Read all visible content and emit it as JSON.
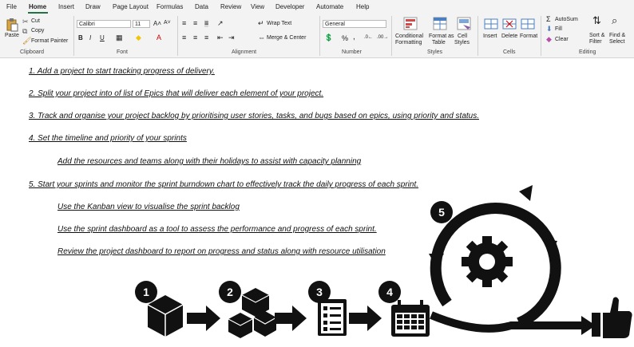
{
  "tabs": [
    "File",
    "Home",
    "Insert",
    "Draw",
    "Page Layout",
    "Formulas",
    "Data",
    "Review",
    "View",
    "Developer",
    "Automate",
    "Help"
  ],
  "clipboard": {
    "paste": "Paste",
    "cut": "Cut",
    "copy": "Copy",
    "format_painter": "Format Painter",
    "label": "Clipboard"
  },
  "font": {
    "name": "Calibri",
    "size": "11",
    "label": "Font",
    "bold": "B",
    "italic": "I",
    "underline": "U"
  },
  "alignment": {
    "wrap": "Wrap Text",
    "merge": "Merge & Center",
    "label": "Alignment"
  },
  "number": {
    "format": "General",
    "label": "Number",
    "percent": "%",
    "comma": ","
  },
  "styles": {
    "conditional": "Conditional",
    "conditional2": "Formatting",
    "format_as": "Format as",
    "format_as2": "Table",
    "cell": "Cell",
    "cell2": "Styles",
    "label": "Styles"
  },
  "cells": {
    "insert": "Insert",
    "delete": "Delete",
    "format": "Format",
    "label": "Cells"
  },
  "editing": {
    "autosum": "AutoSum",
    "fill": "Fill",
    "clear": "Clear",
    "sort": "Sort &",
    "sort2": "Filter",
    "find": "Find &",
    "find2": "Select",
    "label": "Editing"
  },
  "steps": [
    "1. Add a project to start tracking progress of delivery.",
    "2. Split your project into of list of Epics that will deliver each element of your project.",
    "3. Track and organise your project backlog by prioritising user stories, tasks, and bugs based on epics, using priority and status.",
    "4. Set the timeline and priority of your sprints",
    "Add the resources and teams along with their holidays to assist with capacity planning",
    "5. Start your sprints and monitor the sprint burndown chart to effectively track the daily progress of each sprint.",
    "Use the Kanban view to visualise the sprint backlog",
    "Use the sprint dashboard as a tool to assess the performance and progress of each sprint.",
    "Review the project dashboard to report on progress and status along with resource utilisation"
  ],
  "badges": [
    "1",
    "2",
    "3",
    "4",
    "5"
  ],
  "colors": {
    "accent": "#217346",
    "ribbon": "#f3f3f3",
    "ink": "#111111"
  }
}
